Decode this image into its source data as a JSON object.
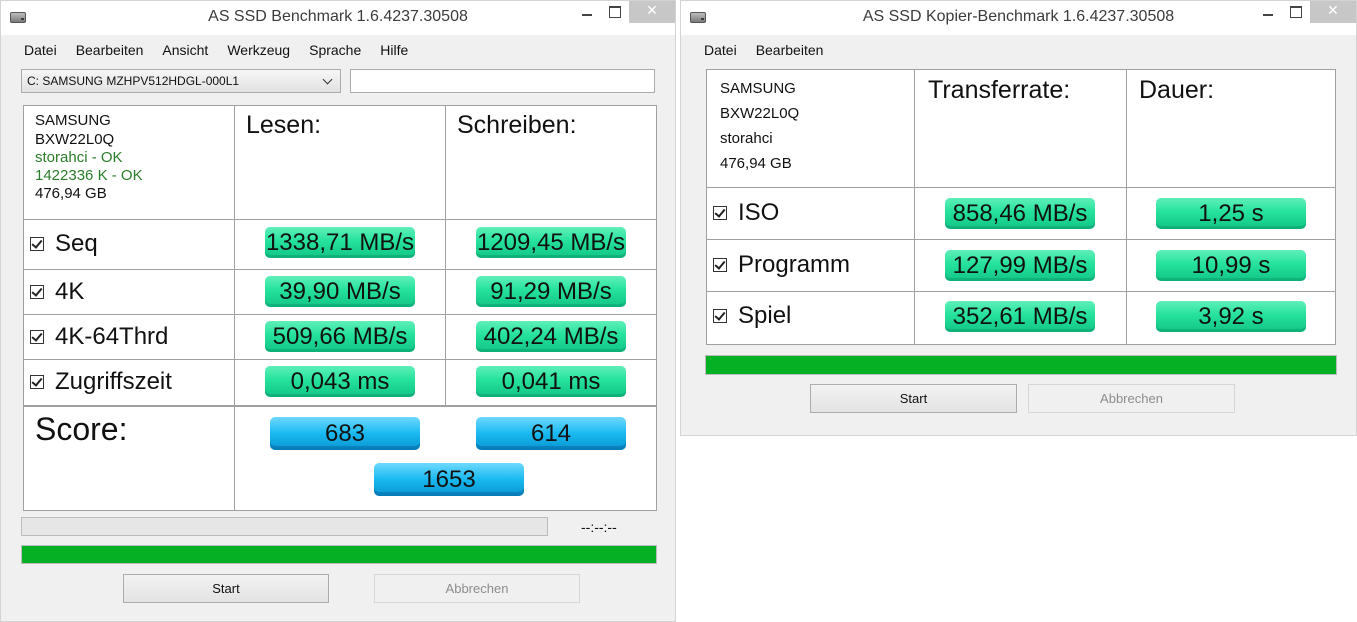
{
  "main": {
    "title": "AS SSD Benchmark 1.6.4237.30508",
    "window_controls": {
      "minimize": "",
      "maximize": "",
      "close": "✕"
    },
    "menu": [
      "Datei",
      "Bearbeiten",
      "Ansicht",
      "Werkzeug",
      "Sprache",
      "Hilfe"
    ],
    "drive_select": {
      "value": "C: SAMSUNG MZHPV512HDGL-000L1"
    },
    "text_input": {
      "value": ""
    },
    "info": {
      "vendor": "SAMSUNG",
      "firmware": "BXW22L0Q",
      "driver": "storahci - OK",
      "alignment": "1422336 K - OK",
      "size": "476,94 GB"
    },
    "headers": {
      "read": "Lesen:",
      "write": "Schreiben:"
    },
    "rows": [
      {
        "label": "Seq",
        "checked": true,
        "read": "1338,71 MB/s",
        "write": "1209,45 MB/s"
      },
      {
        "label": "4K",
        "checked": true,
        "read": "39,90 MB/s",
        "write": "91,29 MB/s"
      },
      {
        "label": "4K-64Thrd",
        "checked": true,
        "read": "509,66 MB/s",
        "write": "402,24 MB/s"
      },
      {
        "label": "Zugriffszeit",
        "checked": true,
        "read": "0,043 ms",
        "write": "0,041 ms"
      }
    ],
    "score": {
      "label": "Score:",
      "read": "683",
      "write": "614",
      "total": "1653"
    },
    "progress": {
      "time": "--:--:--",
      "overall_fraction": 1.0,
      "current_fraction": 0.0
    },
    "buttons": {
      "start": "Start",
      "cancel": "Abbrechen"
    }
  },
  "copy": {
    "title": "AS SSD Kopier-Benchmark 1.6.4237.30508",
    "window_controls": {
      "minimize": "",
      "maximize": "",
      "close": "✕"
    },
    "menu": [
      "Datei",
      "Bearbeiten"
    ],
    "info": {
      "vendor": "SAMSUNG",
      "firmware": "BXW22L0Q",
      "driver": "storahci",
      "size": "476,94 GB"
    },
    "headers": {
      "rate": "Transferrate:",
      "duration": "Dauer:"
    },
    "rows": [
      {
        "label": "ISO",
        "checked": true,
        "rate": "858,46 MB/s",
        "duration": "1,25 s"
      },
      {
        "label": "Programm",
        "checked": true,
        "rate": "127,99 MB/s",
        "duration": "10,99 s"
      },
      {
        "label": "Spiel",
        "checked": true,
        "rate": "352,61 MB/s",
        "duration": "3,92 s"
      }
    ],
    "progress": {
      "fraction": 1.0
    },
    "buttons": {
      "start": "Start",
      "cancel": "Abbrechen"
    }
  },
  "colors": {
    "result_green": "#25e29c",
    "score_blue": "#18b9f0",
    "progress_green": "#06b025",
    "ok_text": "#2a7d2a"
  },
  "icons": {
    "app": "hdd-icon",
    "checkbox": "checkmark-icon",
    "dropdown": "chevron-down-icon"
  }
}
